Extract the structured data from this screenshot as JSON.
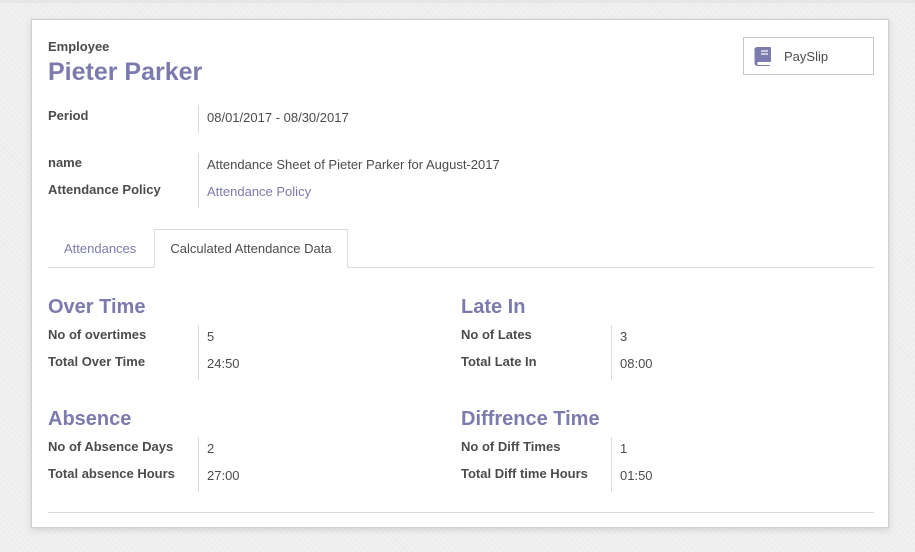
{
  "employee": {
    "label": "Employee",
    "name": "Pieter Parker"
  },
  "payslip_button": {
    "label": "PaySlip",
    "icon": "book-icon",
    "icon_color": "#7c7bad"
  },
  "fields": {
    "period_label": "Period",
    "period_value": "08/01/2017 - 08/30/2017",
    "name_label": "name",
    "name_value": "Attendance Sheet of Pieter Parker for August-2017",
    "policy_label": "Attendance Policy",
    "policy_value": "Attendance Policy"
  },
  "tabs": [
    {
      "label": "Attendances",
      "active": false
    },
    {
      "label": "Calculated Attendance Data",
      "active": true
    }
  ],
  "sections": {
    "overtime": {
      "title": "Over Time",
      "rows": [
        {
          "label": "No of overtimes",
          "value": "5"
        },
        {
          "label": "Total Over Time",
          "value": "24:50"
        }
      ]
    },
    "late_in": {
      "title": "Late In",
      "rows": [
        {
          "label": "No of Lates",
          "value": "3"
        },
        {
          "label": "Total Late In",
          "value": "08:00"
        }
      ]
    },
    "absence": {
      "title": "Absence",
      "rows": [
        {
          "label": "No of Absence Days",
          "value": "2"
        },
        {
          "label": "Total absence Hours",
          "value": "27:00"
        }
      ]
    },
    "diff_time": {
      "title": "Diffrence Time",
      "rows": [
        {
          "label": "No of Diff Times",
          "value": "1"
        },
        {
          "label": "Total Diff time Hours",
          "value": "01:50"
        }
      ]
    }
  },
  "colors": {
    "accent": "#7c7bad",
    "text": "#4c4c4c",
    "border": "#dcdcdc"
  }
}
